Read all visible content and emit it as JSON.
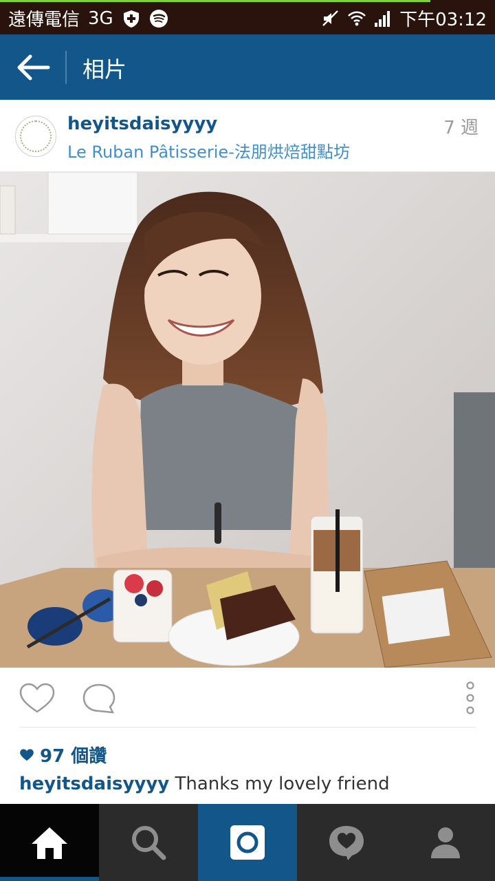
{
  "status_bar": {
    "carrier": "遠傳電信",
    "network": "3G",
    "time": "下午03:12"
  },
  "app_bar": {
    "title": "相片"
  },
  "post": {
    "username": "heyitsdaisyyyy",
    "location": "Le Ruban Pâtisserie-法朋烘焙甜點坊",
    "time_ago": "7 週",
    "likes": "97 個讚",
    "caption_user": "heyitsdaisyyyy",
    "caption_text": "Thanks my lovely friend"
  },
  "colors": {
    "app_bar": "#12568a",
    "status_bar": "#2a130c",
    "link_blue": "#3f8fd1",
    "bottom_nav": "#2b2b2b"
  },
  "icons": [
    "back-arrow-icon",
    "heart-icon",
    "comment-icon",
    "more-vertical-icon",
    "home-icon",
    "search-icon",
    "camera-icon",
    "activity-icon",
    "profile-icon"
  ]
}
